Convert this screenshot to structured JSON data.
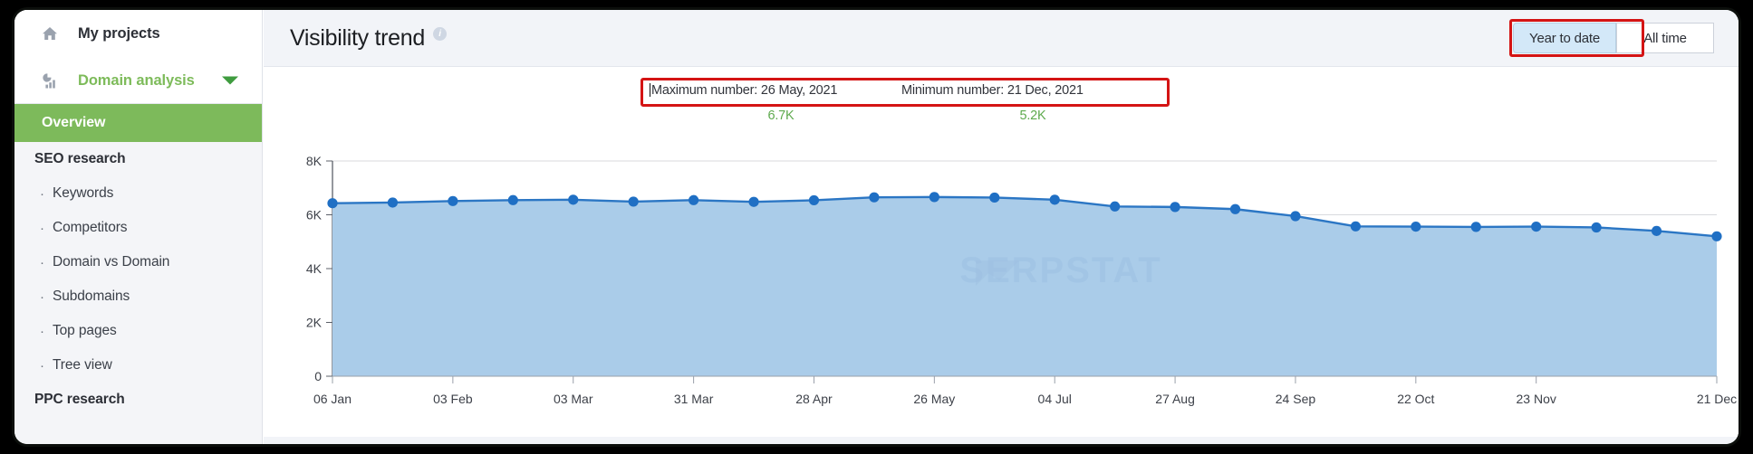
{
  "sidebar": {
    "top_items": [
      {
        "label": "My projects",
        "icon": "home-icon",
        "color": "#2c2f36"
      },
      {
        "label": "Domain analysis",
        "icon": "analytics-icon",
        "color": "#7dbb5a",
        "has_chevron": true
      }
    ],
    "active_item": "Overview",
    "groups": [
      {
        "title": "SEO research",
        "items": [
          "Keywords",
          "Competitors",
          "Domain vs Domain",
          "Subdomains",
          "Top pages",
          "Tree view"
        ]
      },
      {
        "title": "PPC research",
        "items": []
      }
    ],
    "bullet": "·",
    "active_bg": "#7dba5b"
  },
  "header": {
    "title": "Visibility trend",
    "info_icon_glyph": "i",
    "range_buttons": [
      {
        "label": "Year to date",
        "active": true,
        "highlighted": true
      },
      {
        "label": "All time",
        "active": false,
        "highlighted": false
      }
    ]
  },
  "summary": {
    "highlight_color": "#d41414",
    "maximum": {
      "label": "Maximum number: 26 May, 2021",
      "value": "6.7K"
    },
    "minimum": {
      "label": "Minimum number: 21 Dec, 2021",
      "value": "5.2K"
    }
  },
  "watermark": {
    "text": "SERPSTAT"
  },
  "chart_data": {
    "type": "area",
    "title": "Visibility trend",
    "xlabel": "",
    "ylabel": "",
    "ylim": [
      0,
      8000
    ],
    "ytick_values": [
      0,
      2000,
      4000,
      6000,
      8000
    ],
    "ytick_labels": [
      "0",
      "2K",
      "4K",
      "6K",
      "8K"
    ],
    "grid": true,
    "legend": "none",
    "line_color": "#2b76c4",
    "fill_color": "#aacce9",
    "marker_color": "#1f6fc4",
    "xtick_labels": [
      "06 Jan",
      "03 Feb",
      "03 Mar",
      "31 Mar",
      "28 Apr",
      "26 May",
      "04 Jul",
      "27 Aug",
      "24 Sep",
      "22 Oct",
      "23 Nov",
      "21 Dec"
    ],
    "xtick_indices": [
      0,
      2,
      4,
      6,
      8,
      10,
      12,
      14,
      16,
      18,
      20,
      23
    ],
    "x": [
      "06 Jan",
      "20 Jan",
      "03 Feb",
      "17 Feb",
      "03 Mar",
      "17 Mar",
      "31 Mar",
      "14 Apr",
      "28 Apr",
      "12 May",
      "26 May",
      "09 Jun",
      "23 Jun",
      "04 Jul",
      "21 Jul",
      "27 Aug",
      "10 Sep",
      "24 Sep",
      "08 Oct",
      "22 Oct",
      "05 Nov",
      "23 Nov",
      "07 Dec",
      "21 Dec"
    ],
    "series": [
      {
        "name": "Visibility",
        "values": [
          6430,
          6455,
          6510,
          6545,
          6560,
          6490,
          6545,
          6480,
          6540,
          6650,
          6660,
          6640,
          6560,
          6310,
          6290,
          6210,
          5950,
          5570,
          5560,
          5550,
          5560,
          5530,
          5400,
          5200
        ]
      }
    ],
    "annotations": [
      {
        "type": "max",
        "x": "26 May",
        "y": 6700,
        "text": "Maximum number: 26 May, 2021",
        "value_label": "6.7K"
      },
      {
        "type": "min",
        "x": "21 Dec",
        "y": 5200,
        "text": "Minimum number: 21 Dec, 2021",
        "value_label": "5.2K"
      }
    ]
  }
}
